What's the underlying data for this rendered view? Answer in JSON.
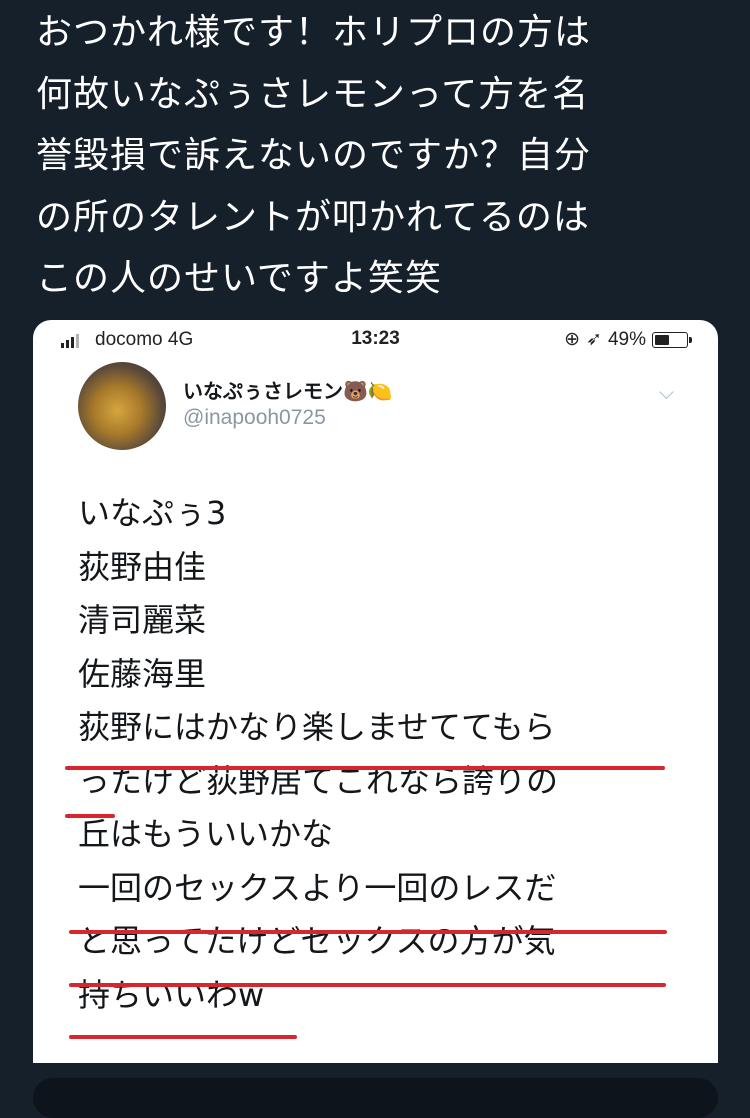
{
  "tweet": {
    "lines": [
      "おつかれ様です！ホリプロの方は",
      "何故いなぷぅさレモンって方を名",
      "誉毀損で訴えないのですか？自分",
      "の所のタレントが叩かれてるのは",
      "この人のせいですよ笑笑"
    ]
  },
  "screenshot": {
    "status": {
      "carrier": "docomo  4G",
      "time": "13:23",
      "battery": "49%",
      "battery_level": 0.49,
      "alarm_icon": "alarm-icon",
      "location_icon": "location-arrow-icon"
    },
    "user": {
      "display_name": "いなぷぅさレモン🐻🍋",
      "handle": "@inapooh0725"
    },
    "body_lines": [
      "いなぷぅ3",
      "荻野由佳",
      "清司麗菜",
      "佐藤海里",
      "荻野にはかなり楽しませててもら",
      "ったけど荻野居てこれなら誇りの",
      "丘はもういいかな",
      "一回のセックスより一回のレスだ",
      "と思ってたけどセックスの方が気",
      "持ちいいわw"
    ],
    "underline_color": "#d8262e"
  }
}
